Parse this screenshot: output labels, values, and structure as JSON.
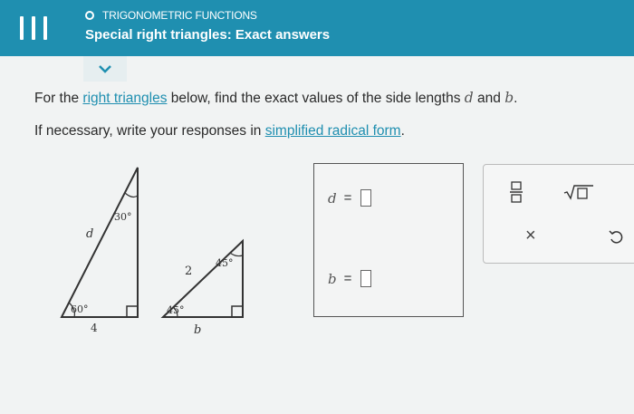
{
  "header": {
    "topic": "TRIGONOMETRIC FUNCTIONS",
    "title": "Special right triangles: Exact answers"
  },
  "question": {
    "line1_before": "For the ",
    "line1_link": "right triangles",
    "line1_mid": " below, find the exact values of the side lengths ",
    "var_d": "d",
    "line1_and": " and ",
    "var_b": "b",
    "line1_end": ".",
    "line2_before": "If necessary, write your responses in ",
    "line2_link": "simplified radical form",
    "line2_end": "."
  },
  "triangle1": {
    "top_angle": "30°",
    "bottom_angle": "60°",
    "hyp_label": "d",
    "base_label": "4"
  },
  "triangle2": {
    "top_angle": "45°",
    "bottom_angle": "45°",
    "hyp_label": "2",
    "base_label": "b"
  },
  "answers": {
    "d_label": "d",
    "b_label": "b",
    "eq": "="
  },
  "toolbox": {
    "fraction_icon": "fraction-icon",
    "sqrt_icon": "square-root-icon",
    "clear_symbol": "×",
    "undo_icon": "undo-icon"
  },
  "colors": {
    "header": "#1f8fb0",
    "link": "#1f8fb0"
  }
}
